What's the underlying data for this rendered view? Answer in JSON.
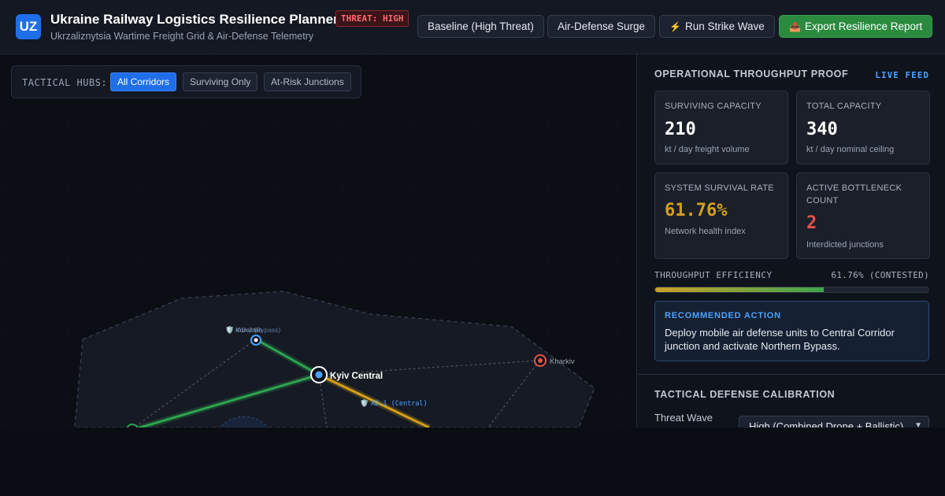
{
  "header": {
    "logo": "UZ",
    "title": "Ukraine Railway Logistics Resilience Planner",
    "threat_badge": "THREAT: HIGH",
    "subtitle": "Ukrzaliznytsia Wartime Freight Grid & Air-Defense Telemetry",
    "buttons": {
      "baseline": "Baseline (High Threat)",
      "surge": "Air-Defense Surge",
      "strike": "Run Strike Wave",
      "strike_icon": "⚡",
      "export": "Export Resilience Report",
      "export_icon": "📤"
    }
  },
  "map": {
    "hubs_label": "TACTICAL HUBS:",
    "filters": [
      "All Corridors",
      "Surviving Only",
      "At-Risk Junctions"
    ],
    "active_filter": "All Corridors",
    "nodes": {
      "kyiv": "Kyiv Central",
      "kharkiv": "Kharkiv",
      "north": "AD-2 (Bypass)",
      "north_overlap": "Korosten",
      "central": "AD-1 (Central)"
    },
    "colors": {
      "surviving": "#2ea44f",
      "contested": "#d4a017",
      "at_risk": "#e5534b",
      "air_defense": "#4aa3ff"
    }
  },
  "panel": {
    "throughput": {
      "title": "OPERATIONAL THROUGHPUT PROOF",
      "live": "LIVE FEED",
      "cards": {
        "surviving": {
          "label": "SURVIVING CAPACITY",
          "value": "210",
          "desc": "kt / day freight volume"
        },
        "total": {
          "label": "TOTAL CAPACITY",
          "value": "340",
          "desc": "kt / day nominal ceiling"
        },
        "survival": {
          "label": "SYSTEM SURVIVAL RATE",
          "value": "61.76%",
          "desc": "Network health index",
          "color": "#d4a017"
        },
        "bottleneck": {
          "label": "ACTIVE BOTTLENECK COUNT",
          "value": "2",
          "desc": "Interdicted junctions",
          "color": "#e5534b"
        }
      },
      "efficiency_label": "THROUGHPUT EFFICIENCY",
      "efficiency_value": "61.76% (CONTESTED)",
      "efficiency_fraction": 0.6176,
      "recommended_title": "RECOMMENDED ACTION",
      "recommended_text": "Deploy mobile air defense units to Central Corridor junction and activate Northern Bypass."
    },
    "calibration": {
      "title": "TACTICAL DEFENSE CALIBRATION",
      "threat_label": "Threat Wave",
      "threat_value": "High (Combined Drone + Ballistic)"
    }
  }
}
